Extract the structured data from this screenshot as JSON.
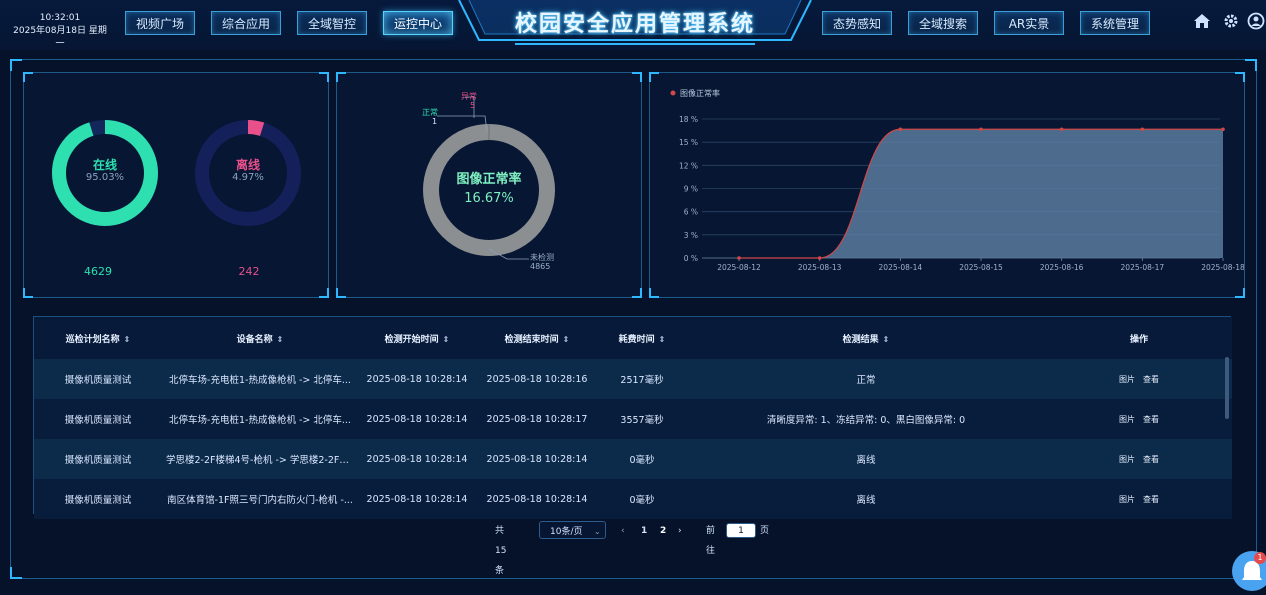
{
  "header": {
    "time": "10:32:01",
    "date": "2025年08月18日 星期一",
    "title": "校园安全应用管理系统",
    "nav_left": [
      "视频广场",
      "综合应用",
      "全域智控",
      "运控中心"
    ],
    "nav_right": [
      "态势感知",
      "全域搜索",
      "AR实景",
      "系统管理"
    ],
    "active": "运控中心"
  },
  "status_panel": {
    "online": {
      "label": "在线",
      "pct": "95.03%",
      "count": "4629",
      "value": 95.03,
      "color": "#2ee0b0"
    },
    "offline": {
      "label": "离线",
      "pct": "4.97%",
      "count": "242",
      "value": 4.97,
      "color": "#e8508a"
    }
  },
  "image_panel": {
    "center_label": "图像正常率",
    "center_value": "16.67%",
    "normal_label": "正常",
    "normal_count": "1",
    "abnormal_label": "异常",
    "abnormal_count": "5",
    "undetected_label": "未检测",
    "undetected_count": "4865"
  },
  "chart_data": {
    "type": "area",
    "legend": "图像正常率",
    "x": [
      "2025-08-12",
      "2025-08-13",
      "2025-08-14",
      "2025-08-15",
      "2025-08-16",
      "2025-08-17",
      "2025-08-18"
    ],
    "values": [
      0,
      0,
      16.67,
      16.67,
      16.67,
      16.67,
      16.67
    ],
    "yticks": [
      "0 %",
      "3 %",
      "6 %",
      "9 %",
      "12 %",
      "15 %",
      "18 %"
    ],
    "ylim": [
      0,
      18
    ],
    "grid": true,
    "legend_position": "top-left",
    "line_color": "#d04848",
    "fill_color": "#5b7a9e"
  },
  "table": {
    "headers": [
      "巡检计划名称",
      "设备名称",
      "检测开始时间",
      "检测结束时间",
      "耗费时间",
      "检测结果",
      "操作"
    ],
    "rows": [
      [
        "摄像机质量测试",
        "北停车场-充电桩1-热成像枪机 -> 北停车...",
        "2025-08-18 10:28:14",
        "2025-08-18 10:28:16",
        "2517毫秒",
        "正常"
      ],
      [
        "摄像机质量测试",
        "北停车场-充电桩1-热成像枪机 -> 北停车...",
        "2025-08-18 10:28:14",
        "2025-08-18 10:28:17",
        "3557毫秒",
        "清晰度异常: 1、冻结异常: 0、黑白图像异常: 0"
      ],
      [
        "摄像机质量测试",
        "学思楼2-2F楼梯4号-枪机 -> 学思楼2-2F楼...",
        "2025-08-18 10:28:14",
        "2025-08-18 10:28:14",
        "0毫秒",
        "离线"
      ],
      [
        "摄像机质量测试",
        "南区体育馆-1F照三号门内右防火门-枪机 -...",
        "2025-08-18 10:28:14",
        "2025-08-18 10:28:14",
        "0毫秒",
        "离线"
      ]
    ],
    "op_image": "图片",
    "op_view": "查看"
  },
  "pagination": {
    "total": "共 15 条",
    "page_size": "10条/页",
    "pages": [
      "1",
      "2"
    ],
    "current": "2",
    "goto_label": "前往",
    "goto_value": "1",
    "page_unit": "页"
  },
  "notification_badge": "1"
}
